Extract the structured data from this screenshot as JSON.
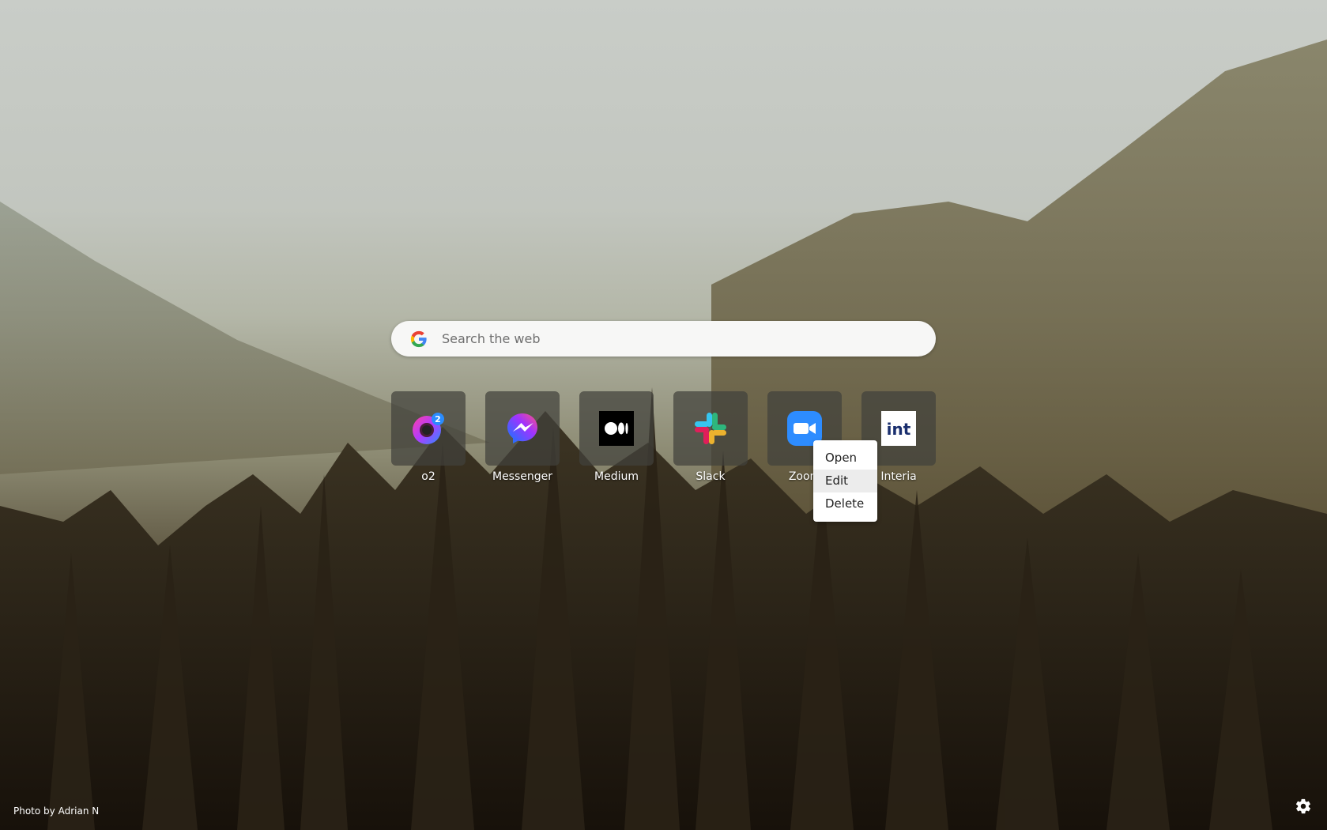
{
  "search": {
    "placeholder": "Search the web"
  },
  "shortcuts": [
    {
      "label": "o2",
      "icon": "o2-icon",
      "badge": "2"
    },
    {
      "label": "Messenger",
      "icon": "messenger-icon"
    },
    {
      "label": "Medium",
      "icon": "medium-icon"
    },
    {
      "label": "Slack",
      "icon": "slack-icon"
    },
    {
      "label": "Zoom",
      "icon": "zoom-icon"
    },
    {
      "label": "Interia",
      "icon": "interia-icon",
      "icon_text": "int"
    }
  ],
  "context_menu": {
    "items": [
      "Open",
      "Edit",
      "Delete"
    ],
    "highlighted": "Edit"
  },
  "footer": {
    "photo_credit": "Photo by Adrian N"
  },
  "colors": {
    "zoom_blue": "#2d8cff",
    "interia_navy": "#1a2f6e",
    "messenger_gradient": [
      "#0a7cff",
      "#a033ff",
      "#ff5280"
    ]
  }
}
